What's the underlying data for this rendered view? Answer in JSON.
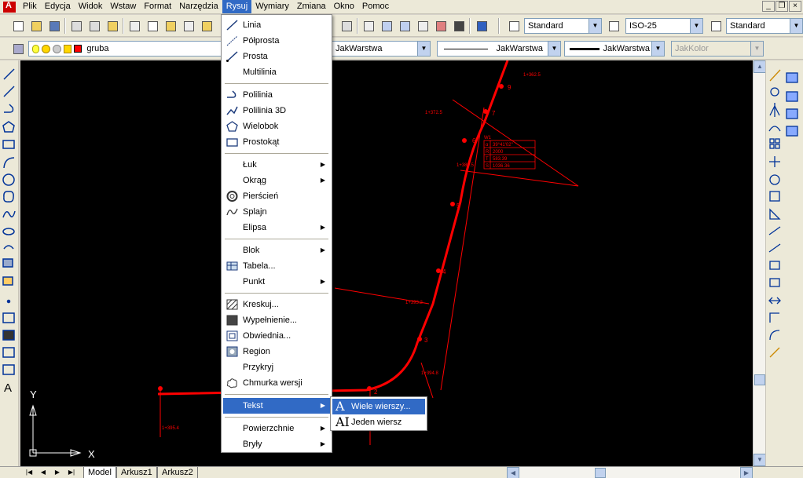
{
  "menubar": {
    "items": [
      "Plik",
      "Edycja",
      "Widok",
      "Wstaw",
      "Format",
      "Narzędzia",
      "Rysuj",
      "Wymiary",
      "Zmiana",
      "Okno",
      "Pomoc"
    ],
    "active": "Rysuj"
  },
  "window": {
    "minimize": "_",
    "restore": "❐",
    "close": "×"
  },
  "toolbar1": {
    "text_style": "Standard",
    "dim_style": "ISO-25",
    "table_style": "Standard"
  },
  "toolbar2": {
    "layer_name": "gruba",
    "layer_color": "#ff0000",
    "color_combo": "JakWarstwa",
    "linetype_combo": "JakWarstwa",
    "lineweight_combo": "JakWarstwa",
    "plotstyle_combo": "JakKolor"
  },
  "rysuj_menu": {
    "items": [
      {
        "label": "Linia",
        "icon": "line-icon"
      },
      {
        "label": "Półprosta",
        "icon": "ray-icon"
      },
      {
        "label": "Prosta",
        "icon": "xline-icon"
      },
      {
        "label": "Multilinia",
        "icon": ""
      },
      {
        "sep": true
      },
      {
        "label": "Polilinia",
        "icon": "polyline-icon"
      },
      {
        "label": "Polilinia 3D",
        "icon": "polyline3d-icon"
      },
      {
        "label": "Wielobok",
        "icon": "polygon-icon"
      },
      {
        "label": "Prostokąt",
        "icon": "rectangle-icon"
      },
      {
        "sep": true
      },
      {
        "label": "Łuk",
        "icon": "",
        "submenu": true
      },
      {
        "label": "Okrąg",
        "icon": "",
        "submenu": true
      },
      {
        "label": "Pierścień",
        "icon": "donut-icon"
      },
      {
        "label": "Splajn",
        "icon": "spline-icon"
      },
      {
        "label": "Elipsa",
        "icon": "",
        "submenu": true
      },
      {
        "sep": true
      },
      {
        "label": "Blok",
        "icon": "",
        "submenu": true
      },
      {
        "label": "Tabela...",
        "icon": "table-icon"
      },
      {
        "label": "Punkt",
        "icon": "",
        "submenu": true
      },
      {
        "sep": true
      },
      {
        "label": "Kreskuj...",
        "icon": "hatch-icon"
      },
      {
        "label": "Wypełnienie...",
        "icon": "gradient-icon"
      },
      {
        "label": "Obwiednia...",
        "icon": "boundary-icon"
      },
      {
        "label": "Region",
        "icon": "region-icon"
      },
      {
        "label": "Przykryj",
        "icon": ""
      },
      {
        "label": "Chmurka wersji",
        "icon": "revcloud-icon"
      },
      {
        "sep": true
      },
      {
        "label": "Tekst",
        "icon": "",
        "submenu": true,
        "highlight": true
      },
      {
        "sep": true
      },
      {
        "label": "Powierzchnie",
        "icon": "",
        "submenu": true
      },
      {
        "label": "Bryły",
        "icon": "",
        "submenu": true
      }
    ]
  },
  "tekst_submenu": {
    "items": [
      {
        "label": "Wiele wierszy...",
        "glyph": "A",
        "highlight": true
      },
      {
        "label": "Jeden wiersz",
        "glyph": "AI",
        "highlight": false
      }
    ]
  },
  "ucs": {
    "x_label": "X",
    "y_label": "Y"
  },
  "drawing": {
    "stroke_color": "#ff0000",
    "table_values": [
      "39°41'02\"",
      "2000",
      "583.39",
      "1036.36"
    ],
    "table_rows": [
      "α",
      "R",
      "T",
      "S"
    ],
    "table_header": "W1",
    "station_labels": [
      "9",
      "7",
      "6",
      "5",
      "4",
      "3",
      "2"
    ],
    "small_labels": [
      "1+362.5",
      "1+372.5",
      "1+380.5",
      "1+393.2",
      "1+394.8",
      "1+395.4"
    ]
  },
  "tabs": {
    "items": [
      "Model",
      "Arkusz1",
      "Arkusz2"
    ],
    "active": "Model"
  }
}
